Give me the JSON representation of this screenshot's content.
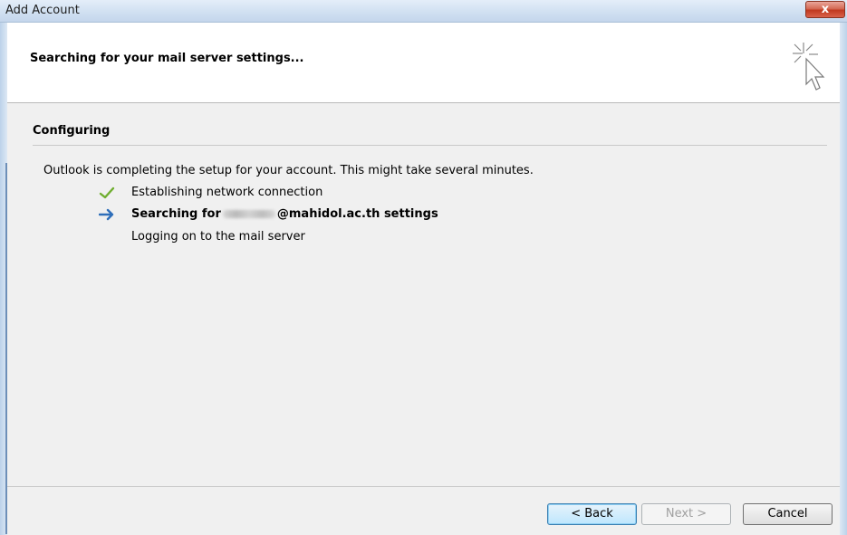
{
  "window": {
    "title": "Add Account",
    "close_symbol": "x"
  },
  "header": {
    "title": "Searching for your mail server settings...",
    "icon": "cursor-sparkle-icon"
  },
  "section": {
    "label": "Configuring",
    "intro": "Outlook is completing the setup for your account. This might take several minutes."
  },
  "steps": [
    {
      "icon": "checkmark-icon",
      "status": "done",
      "text": "Establishing network connection"
    },
    {
      "icon": "arrow-right-icon",
      "status": "current",
      "text_prefix": "Searching for",
      "text_suffix": "@mahidol.ac.th settings"
    },
    {
      "icon": "",
      "status": "pending",
      "text": "Logging on to the mail server"
    }
  ],
  "buttons": {
    "back": "< Back",
    "next": "Next >",
    "cancel": "Cancel"
  },
  "colors": {
    "check": "#6fae2f",
    "arrow": "#2f6fba",
    "close": "#c0391f"
  }
}
